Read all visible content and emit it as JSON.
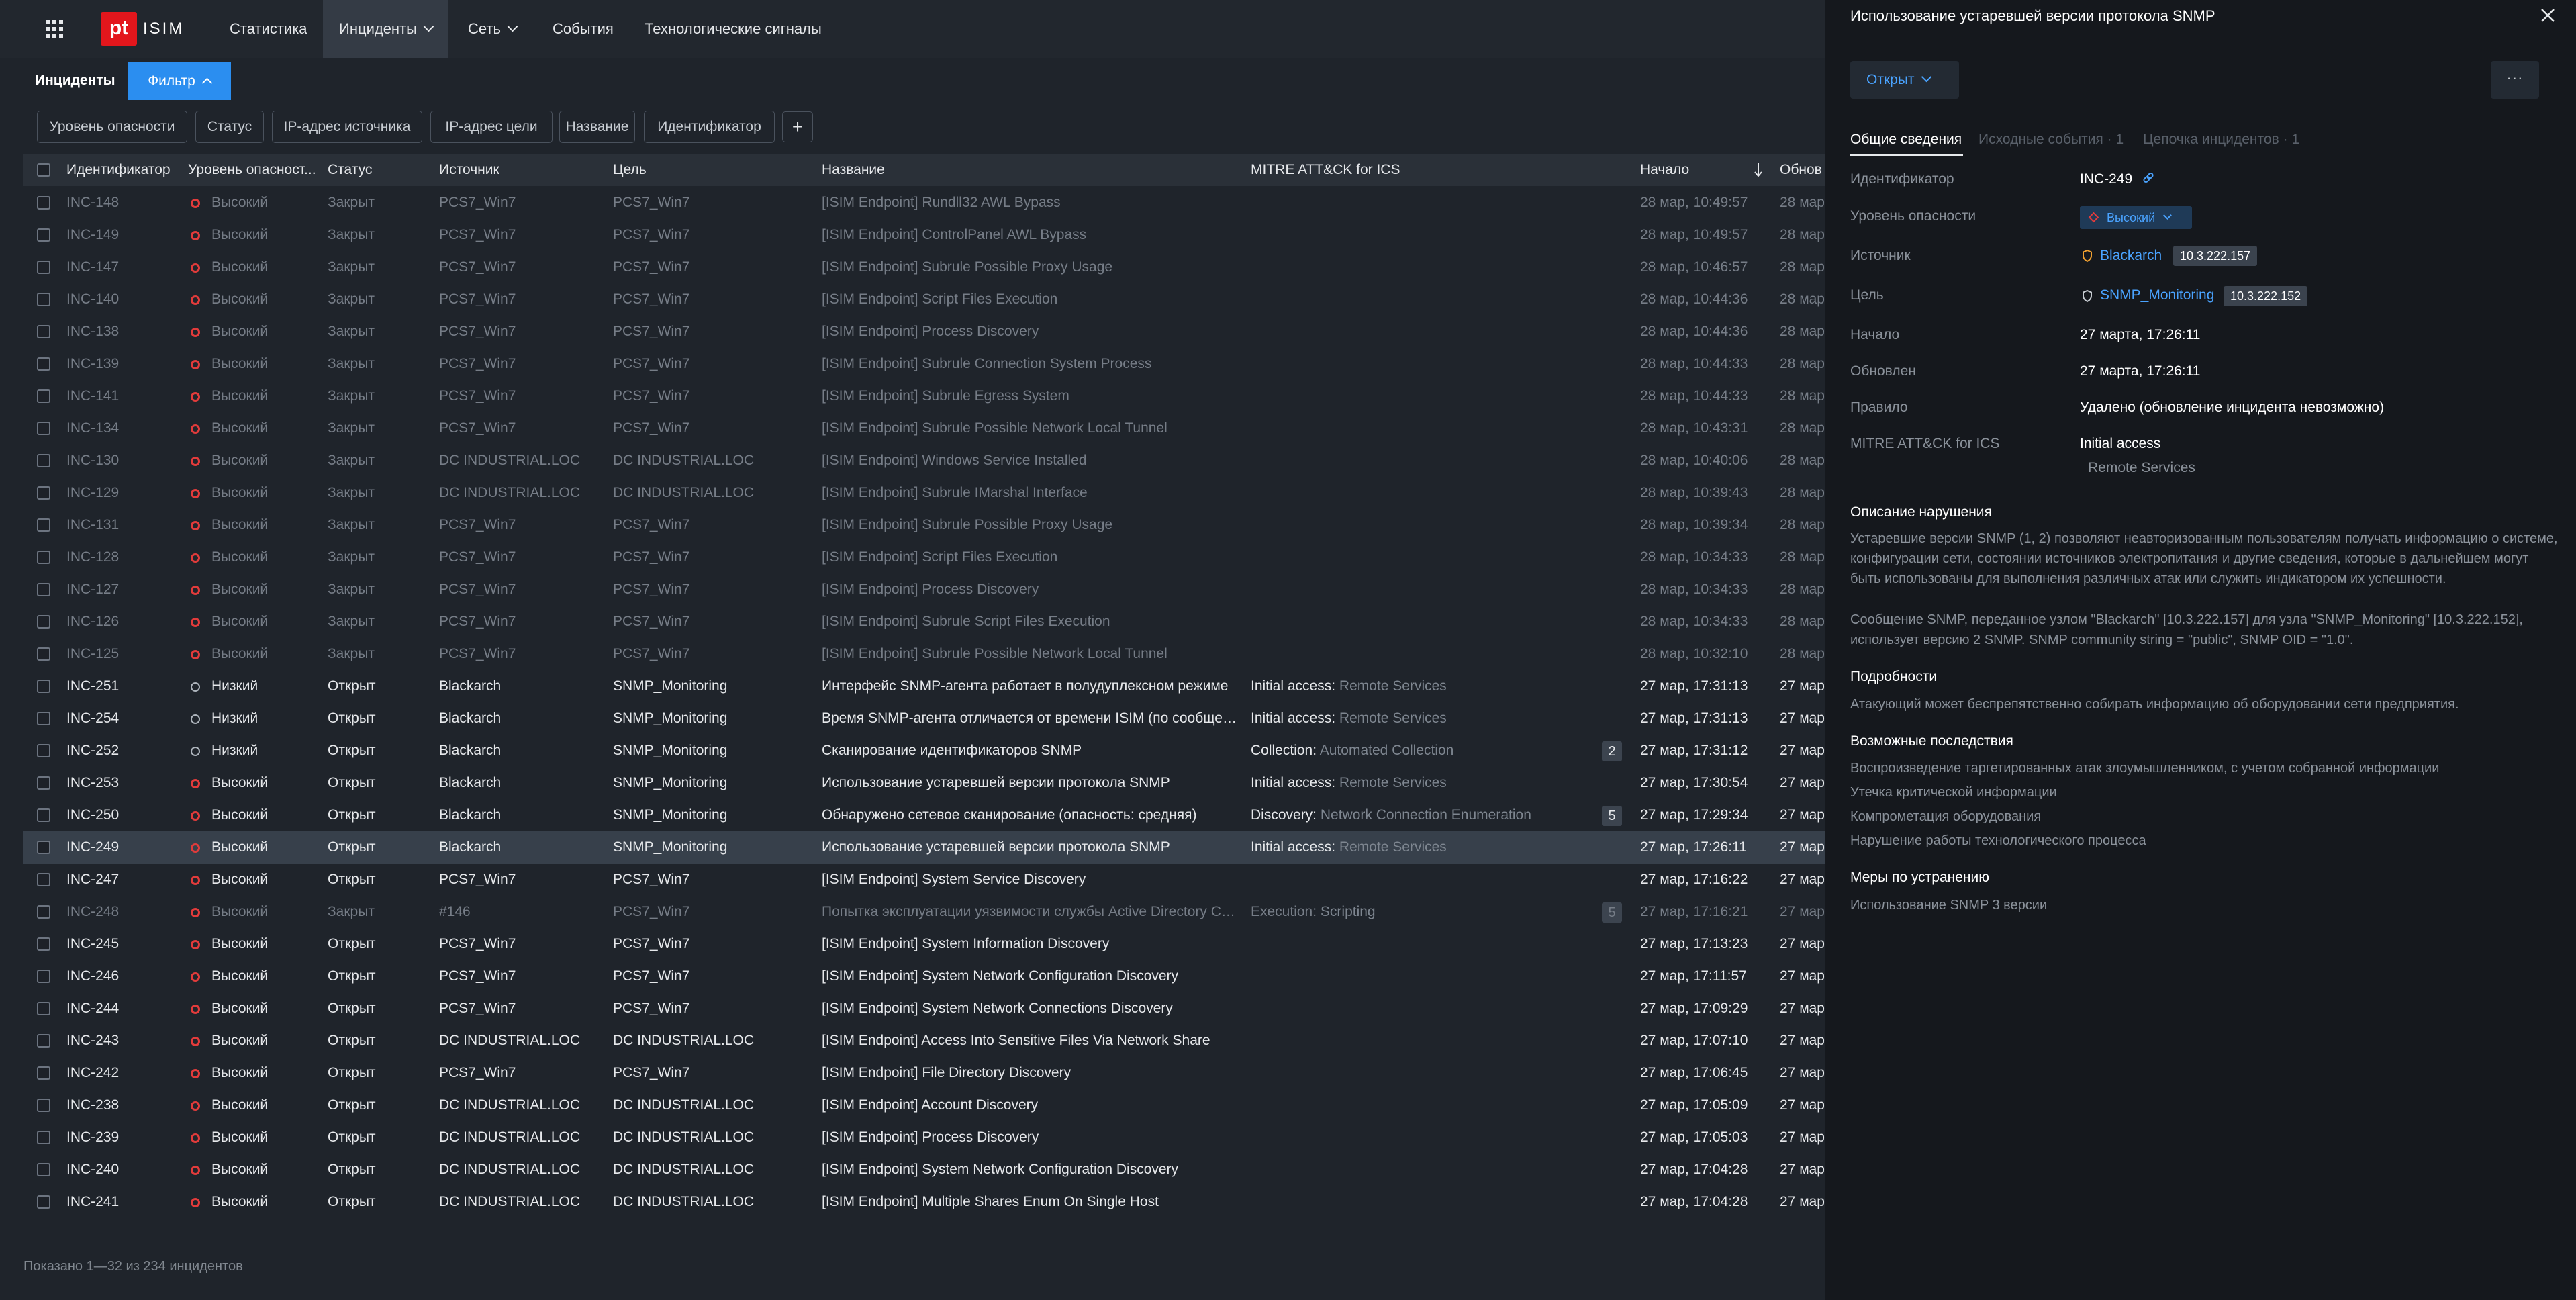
{
  "nav": {
    "product": "ISIM",
    "logo": "pt",
    "items": [
      {
        "label": "Статистика"
      },
      {
        "label": "Инциденты"
      },
      {
        "label": "Сеть"
      },
      {
        "label": "События"
      },
      {
        "label": "Технологические сигналы"
      }
    ]
  },
  "page": {
    "title": "Инциденты",
    "filter_button": "Фильтр",
    "chips": [
      "Уровень опасности",
      "Статус",
      "IP-адрес источника",
      "IP-адрес цели",
      "Название",
      "Идентификатор"
    ],
    "pager": "Показано 1—32 из 234 инцидентов"
  },
  "table": {
    "columns": [
      "Идентификатор",
      "Уровень опасност...",
      "Статус",
      "Источник",
      "Цель",
      "Название",
      "MITRE ATT&CK for ICS",
      "Начало",
      "Обнов"
    ],
    "rows": [
      {
        "id": "INC-148",
        "sev": "Высокий",
        "sevkey": "hi",
        "status": "Закрыт",
        "src": "PCS7_Win7",
        "dst": "PCS7_Win7",
        "name": "[ISIM Endpoint] Rundll32 AWL Bypass",
        "tactic": "",
        "tech": "",
        "cnt": "",
        "start": "28 мар, 10:49:57",
        "upd": "28 мар"
      },
      {
        "id": "INC-149",
        "sev": "Высокий",
        "sevkey": "hi",
        "status": "Закрыт",
        "src": "PCS7_Win7",
        "dst": "PCS7_Win7",
        "name": "[ISIM Endpoint] ControlPanel AWL Bypass",
        "tactic": "",
        "tech": "",
        "cnt": "",
        "start": "28 мар, 10:49:57",
        "upd": "28 мар"
      },
      {
        "id": "INC-147",
        "sev": "Высокий",
        "sevkey": "hi",
        "status": "Закрыт",
        "src": "PCS7_Win7",
        "dst": "PCS7_Win7",
        "name": "[ISIM Endpoint] Subrule Possible Proxy Usage",
        "tactic": "",
        "tech": "",
        "cnt": "",
        "start": "28 мар, 10:46:57",
        "upd": "28 мар"
      },
      {
        "id": "INC-140",
        "sev": "Высокий",
        "sevkey": "hi",
        "status": "Закрыт",
        "src": "PCS7_Win7",
        "dst": "PCS7_Win7",
        "name": "[ISIM Endpoint] Script Files Execution",
        "tactic": "",
        "tech": "",
        "cnt": "",
        "start": "28 мар, 10:44:36",
        "upd": "28 мар"
      },
      {
        "id": "INC-138",
        "sev": "Высокий",
        "sevkey": "hi",
        "status": "Закрыт",
        "src": "PCS7_Win7",
        "dst": "PCS7_Win7",
        "name": "[ISIM Endpoint] Process Discovery",
        "tactic": "",
        "tech": "",
        "cnt": "",
        "start": "28 мар, 10:44:36",
        "upd": "28 мар"
      },
      {
        "id": "INC-139",
        "sev": "Высокий",
        "sevkey": "hi",
        "status": "Закрыт",
        "src": "PCS7_Win7",
        "dst": "PCS7_Win7",
        "name": "[ISIM Endpoint] Subrule Connection System Process",
        "tactic": "",
        "tech": "",
        "cnt": "",
        "start": "28 мар, 10:44:33",
        "upd": "28 мар"
      },
      {
        "id": "INC-141",
        "sev": "Высокий",
        "sevkey": "hi",
        "status": "Закрыт",
        "src": "PCS7_Win7",
        "dst": "PCS7_Win7",
        "name": "[ISIM Endpoint] Subrule Egress System",
        "tactic": "",
        "tech": "",
        "cnt": "",
        "start": "28 мар, 10:44:33",
        "upd": "28 мар"
      },
      {
        "id": "INC-134",
        "sev": "Высокий",
        "sevkey": "hi",
        "status": "Закрыт",
        "src": "PCS7_Win7",
        "dst": "PCS7_Win7",
        "name": "[ISIM Endpoint] Subrule Possible Network Local Tunnel",
        "tactic": "",
        "tech": "",
        "cnt": "",
        "start": "28 мар, 10:43:31",
        "upd": "28 мар"
      },
      {
        "id": "INC-130",
        "sev": "Высокий",
        "sevkey": "hi",
        "status": "Закрыт",
        "src": "DC INDUSTRIAL.LOC",
        "dst": "DC INDUSTRIAL.LOC",
        "name": "[ISIM Endpoint] Windows Service Installed",
        "tactic": "",
        "tech": "",
        "cnt": "",
        "start": "28 мар, 10:40:06",
        "upd": "28 мар"
      },
      {
        "id": "INC-129",
        "sev": "Высокий",
        "sevkey": "hi",
        "status": "Закрыт",
        "src": "DC INDUSTRIAL.LOC",
        "dst": "DC INDUSTRIAL.LOC",
        "name": "[ISIM Endpoint] Subrule IMarshal Interface",
        "tactic": "",
        "tech": "",
        "cnt": "",
        "start": "28 мар, 10:39:43",
        "upd": "28 мар"
      },
      {
        "id": "INC-131",
        "sev": "Высокий",
        "sevkey": "hi",
        "status": "Закрыт",
        "src": "PCS7_Win7",
        "dst": "PCS7_Win7",
        "name": "[ISIM Endpoint] Subrule Possible Proxy Usage",
        "tactic": "",
        "tech": "",
        "cnt": "",
        "start": "28 мар, 10:39:34",
        "upd": "28 мар"
      },
      {
        "id": "INC-128",
        "sev": "Высокий",
        "sevkey": "hi",
        "status": "Закрыт",
        "src": "PCS7_Win7",
        "dst": "PCS7_Win7",
        "name": "[ISIM Endpoint] Script Files Execution",
        "tactic": "",
        "tech": "",
        "cnt": "",
        "start": "28 мар, 10:34:33",
        "upd": "28 мар"
      },
      {
        "id": "INC-127",
        "sev": "Высокий",
        "sevkey": "hi",
        "status": "Закрыт",
        "src": "PCS7_Win7",
        "dst": "PCS7_Win7",
        "name": "[ISIM Endpoint] Process Discovery",
        "tactic": "",
        "tech": "",
        "cnt": "",
        "start": "28 мар, 10:34:33",
        "upd": "28 мар"
      },
      {
        "id": "INC-126",
        "sev": "Высокий",
        "sevkey": "hi",
        "status": "Закрыт",
        "src": "PCS7_Win7",
        "dst": "PCS7_Win7",
        "name": "[ISIM Endpoint] Subrule Script Files Execution",
        "tactic": "",
        "tech": "",
        "cnt": "",
        "start": "28 мар, 10:34:33",
        "upd": "28 мар"
      },
      {
        "id": "INC-125",
        "sev": "Высокий",
        "sevkey": "hi",
        "status": "Закрыт",
        "src": "PCS7_Win7",
        "dst": "PCS7_Win7",
        "name": "[ISIM Endpoint] Subrule Possible Network Local Tunnel",
        "tactic": "",
        "tech": "",
        "cnt": "",
        "start": "28 мар, 10:32:10",
        "upd": "28 мар"
      },
      {
        "id": "INC-251",
        "sev": "Низкий",
        "sevkey": "lo",
        "status": "Открыт",
        "src": "Blackarch",
        "dst": "SNMP_Monitoring",
        "name": "Интерфейс SNMP-агента работает в полудуплексном режиме",
        "tactic": "Initial access:",
        "tech": "Remote Services",
        "cnt": "",
        "start": "27 мар, 17:31:13",
        "upd": "27 мар"
      },
      {
        "id": "INC-254",
        "sev": "Низкий",
        "sevkey": "lo",
        "status": "Открыт",
        "src": "Blackarch",
        "dst": "SNMP_Monitoring",
        "name": "Время SNMP-агента отличается от времени ISIM (по сообщению)",
        "tactic": "Initial access:",
        "tech": "Remote Services",
        "cnt": "",
        "start": "27 мар, 17:31:13",
        "upd": "27 мар"
      },
      {
        "id": "INC-252",
        "sev": "Низкий",
        "sevkey": "lo",
        "status": "Открыт",
        "src": "Blackarch",
        "dst": "SNMP_Monitoring",
        "name": "Сканирование идентификаторов SNMP",
        "tactic": "Collection:",
        "tech": "Automated Collection",
        "cnt": "2",
        "start": "27 мар, 17:31:12",
        "upd": "27 мар"
      },
      {
        "id": "INC-253",
        "sev": "Высокий",
        "sevkey": "hi",
        "status": "Открыт",
        "src": "Blackarch",
        "dst": "SNMP_Monitoring",
        "name": "Использование устаревшей версии протокола SNMP",
        "tactic": "Initial access:",
        "tech": "Remote Services",
        "cnt": "",
        "start": "27 мар, 17:30:54",
        "upd": "27 мар"
      },
      {
        "id": "INC-250",
        "sev": "Высокий",
        "sevkey": "hi",
        "status": "Открыт",
        "src": "Blackarch",
        "dst": "SNMP_Monitoring",
        "name": "Обнаружено сетевое сканирование (опасность: средняя)",
        "tactic": "Discovery:",
        "tech": "Network Connection Enumeration",
        "cnt": "5",
        "start": "27 мар, 17:29:34",
        "upd": "27 мар"
      },
      {
        "id": "INC-249",
        "sev": "Высокий",
        "sevkey": "hi",
        "status": "Открыт",
        "src": "Blackarch",
        "dst": "SNMP_Monitoring",
        "name": "Использование устаревшей версии протокола SNMP",
        "tactic": "Initial access:",
        "tech": "Remote Services",
        "cnt": "",
        "start": "27 мар, 17:26:11",
        "upd": "27 мар",
        "selected": true
      },
      {
        "id": "INC-247",
        "sev": "Высокий",
        "sevkey": "hi",
        "status": "Открыт",
        "src": "PCS7_Win7",
        "dst": "PCS7_Win7",
        "name": "[ISIM Endpoint] System Service Discovery",
        "tactic": "",
        "tech": "",
        "cnt": "",
        "start": "27 мар, 17:16:22",
        "upd": "27 мар"
      },
      {
        "id": "INC-248",
        "sev": "Высокий",
        "sevkey": "hi",
        "status": "Закрыт",
        "src": "#146",
        "dst": "PCS7_Win7",
        "name": "Попытка эксплуатации уязвимости службы Active Directory Certificate Services",
        "tactic": "Execution:",
        "tech": "Scripting",
        "cnt": "5",
        "start": "27 мар, 17:16:21",
        "upd": "27 мар"
      },
      {
        "id": "INC-245",
        "sev": "Высокий",
        "sevkey": "hi",
        "status": "Открыт",
        "src": "PCS7_Win7",
        "dst": "PCS7_Win7",
        "name": "[ISIM Endpoint] System Information Discovery",
        "tactic": "",
        "tech": "",
        "cnt": "",
        "start": "27 мар, 17:13:23",
        "upd": "27 мар"
      },
      {
        "id": "INC-246",
        "sev": "Высокий",
        "sevkey": "hi",
        "status": "Открыт",
        "src": "PCS7_Win7",
        "dst": "PCS7_Win7",
        "name": "[ISIM Endpoint] System Network Configuration Discovery",
        "tactic": "",
        "tech": "",
        "cnt": "",
        "start": "27 мар, 17:11:57",
        "upd": "27 мар"
      },
      {
        "id": "INC-244",
        "sev": "Высокий",
        "sevkey": "hi",
        "status": "Открыт",
        "src": "PCS7_Win7",
        "dst": "PCS7_Win7",
        "name": "[ISIM Endpoint] System Network Connections Discovery",
        "tactic": "",
        "tech": "",
        "cnt": "",
        "start": "27 мар, 17:09:29",
        "upd": "27 мар"
      },
      {
        "id": "INC-243",
        "sev": "Высокий",
        "sevkey": "hi",
        "status": "Открыт",
        "src": "DC INDUSTRIAL.LOC",
        "dst": "DC INDUSTRIAL.LOC",
        "name": "[ISIM Endpoint] Access Into Sensitive Files Via Network Share",
        "tactic": "",
        "tech": "",
        "cnt": "",
        "start": "27 мар, 17:07:10",
        "upd": "27 мар"
      },
      {
        "id": "INC-242",
        "sev": "Высокий",
        "sevkey": "hi",
        "status": "Открыт",
        "src": "PCS7_Win7",
        "dst": "PCS7_Win7",
        "name": "[ISIM Endpoint] File Directory Discovery",
        "tactic": "",
        "tech": "",
        "cnt": "",
        "start": "27 мар, 17:06:45",
        "upd": "27 мар"
      },
      {
        "id": "INC-238",
        "sev": "Высокий",
        "sevkey": "hi",
        "status": "Открыт",
        "src": "DC INDUSTRIAL.LOC",
        "dst": "DC INDUSTRIAL.LOC",
        "name": "[ISIM Endpoint] Account Discovery",
        "tactic": "",
        "tech": "",
        "cnt": "",
        "start": "27 мар, 17:05:09",
        "upd": "27 мар"
      },
      {
        "id": "INC-239",
        "sev": "Высокий",
        "sevkey": "hi",
        "status": "Открыт",
        "src": "DC INDUSTRIAL.LOC",
        "dst": "DC INDUSTRIAL.LOC",
        "name": "[ISIM Endpoint] Process Discovery",
        "tactic": "",
        "tech": "",
        "cnt": "",
        "start": "27 мар, 17:05:03",
        "upd": "27 мар"
      },
      {
        "id": "INC-240",
        "sev": "Высокий",
        "sevkey": "hi",
        "status": "Открыт",
        "src": "DC INDUSTRIAL.LOC",
        "dst": "DC INDUSTRIAL.LOC",
        "name": "[ISIM Endpoint] System Network Configuration Discovery",
        "tactic": "",
        "tech": "",
        "cnt": "",
        "start": "27 мар, 17:04:28",
        "upd": "27 мар"
      },
      {
        "id": "INC-241",
        "sev": "Высокий",
        "sevkey": "hi",
        "status": "Открыт",
        "src": "DC INDUSTRIAL.LOC",
        "dst": "DC INDUSTRIAL.LOC",
        "name": "[ISIM Endpoint] Multiple Shares Enum On Single Host",
        "tactic": "",
        "tech": "",
        "cnt": "",
        "start": "27 мар, 17:04:28",
        "upd": "27 мар"
      }
    ]
  },
  "panel": {
    "title": "Использование устаревшей версии протокола SNMP",
    "status": "Открыт",
    "more": "···",
    "tabs": [
      "Общие сведения",
      "Исходные события · 1",
      "Цепочка инцидентов · 1"
    ],
    "labels": {
      "id": "Идентификатор",
      "severity": "Уровень опасности",
      "source": "Источник",
      "target": "Цель",
      "start": "Начало",
      "updated": "Обновлен",
      "rule": "Правило",
      "mitre": "MITRE ATT&CK for ICS"
    },
    "values": {
      "id": "INC-249",
      "severity": "Высокий",
      "source_name": "Blackarch",
      "source_ip": "10.3.222.157",
      "target_name": "SNMP_Monitoring",
      "target_ip": "10.3.222.152",
      "start": "27 марта, 17:26:11",
      "updated": "27 марта, 17:26:11",
      "rule": "Удалено (обновление инцидента невозможно)",
      "mitre_tactic": "Initial access",
      "mitre_technique": "Remote Services"
    },
    "description_title": "Описание нарушения",
    "description": "Устаревшие версии SNMP (1, 2) позволяют неавторизованным пользователям получать информацию о системе, конфигурации сети, состоянии источников электропитания и другие сведения, которые в дальнейшем могут быть использованы для выполнения различных атак или служить индикатором их успешности.",
    "description_2": "Сообщение SNMP, переданное узлом \"Blackarch\" [10.3.222.157] для узла \"SNMP_Monitoring\" [10.3.222.152], использует версию 2 SNMP. SNMP community string = \"public\", SNMP OID = \"1.0\".",
    "details_title": "Подробности",
    "details": "Атакующий может беспрепятственно собирать информацию об оборудовании сети предприятия.",
    "consequences_title": "Возможные последствия",
    "consequences": [
      "Воспроизведение таргетированных атак злоумышленником, с учетом собранной информации",
      "Утечка критической информации",
      "Компрометация оборудования",
      "Нарушение работы технологического процесса"
    ],
    "remediation_title": "Меры по устранению",
    "remediation": "Использование SNMP 3 версии"
  },
  "colors": {
    "accent": "#2b8ef0",
    "link": "#4aa3ff",
    "high": "#e23b3b",
    "brand": "#e3161c"
  }
}
